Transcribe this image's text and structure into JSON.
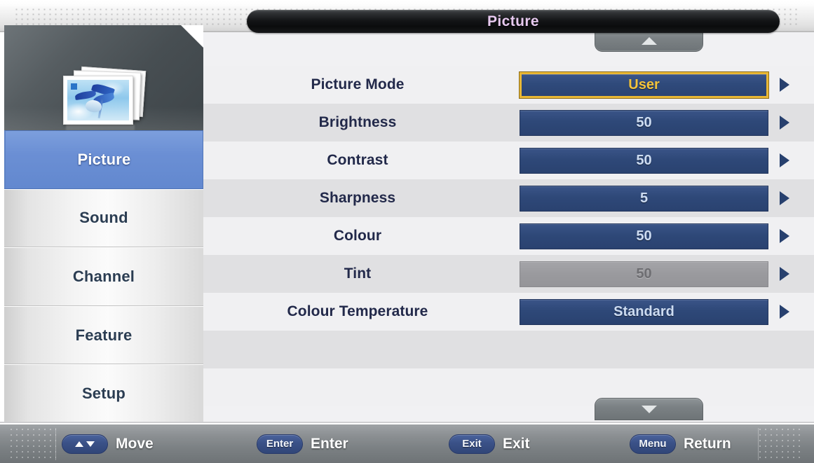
{
  "header": {
    "title": "Picture"
  },
  "sidebar": {
    "icon": "picture-stack-icon",
    "items": [
      {
        "label": "Picture",
        "selected": true
      },
      {
        "label": "Sound",
        "selected": false
      },
      {
        "label": "Channel",
        "selected": false
      },
      {
        "label": "Feature",
        "selected": false
      },
      {
        "label": "Setup",
        "selected": false
      }
    ]
  },
  "scroll": {
    "up_icon": "triangle-up-icon",
    "down_icon": "triangle-down-icon"
  },
  "settings": {
    "rows": [
      {
        "label": "Picture Mode",
        "value": "User",
        "selected": true,
        "disabled": false
      },
      {
        "label": "Brightness",
        "value": "50",
        "selected": false,
        "disabled": false
      },
      {
        "label": "Contrast",
        "value": "50",
        "selected": false,
        "disabled": false
      },
      {
        "label": "Sharpness",
        "value": "5",
        "selected": false,
        "disabled": false
      },
      {
        "label": "Colour",
        "value": "50",
        "selected": false,
        "disabled": false
      },
      {
        "label": "Tint",
        "value": "50",
        "selected": false,
        "disabled": true
      },
      {
        "label": "Colour Temperature",
        "value": "Standard",
        "selected": false,
        "disabled": false
      }
    ],
    "arrow_icon": "triangle-right-icon"
  },
  "footer": {
    "hints": [
      {
        "badge": "",
        "action": "Move",
        "icon": "up-down-arrows-icon"
      },
      {
        "badge": "Enter",
        "action": "Enter",
        "icon": ""
      },
      {
        "badge": "Exit",
        "action": "Exit",
        "icon": ""
      },
      {
        "badge": "Menu",
        "action": "Return",
        "icon": ""
      }
    ]
  },
  "colors": {
    "title_text": "#e7c9ef",
    "selected_sidebar": "#6b8fd4",
    "value_bar": "#2e4878",
    "value_text": "#cddcf2",
    "highlight_border": "#e9b734",
    "highlight_text": "#f3c33b",
    "disabled_bar": "#9a9a9e",
    "label_text": "#22294a",
    "badge": "#3a5187"
  }
}
